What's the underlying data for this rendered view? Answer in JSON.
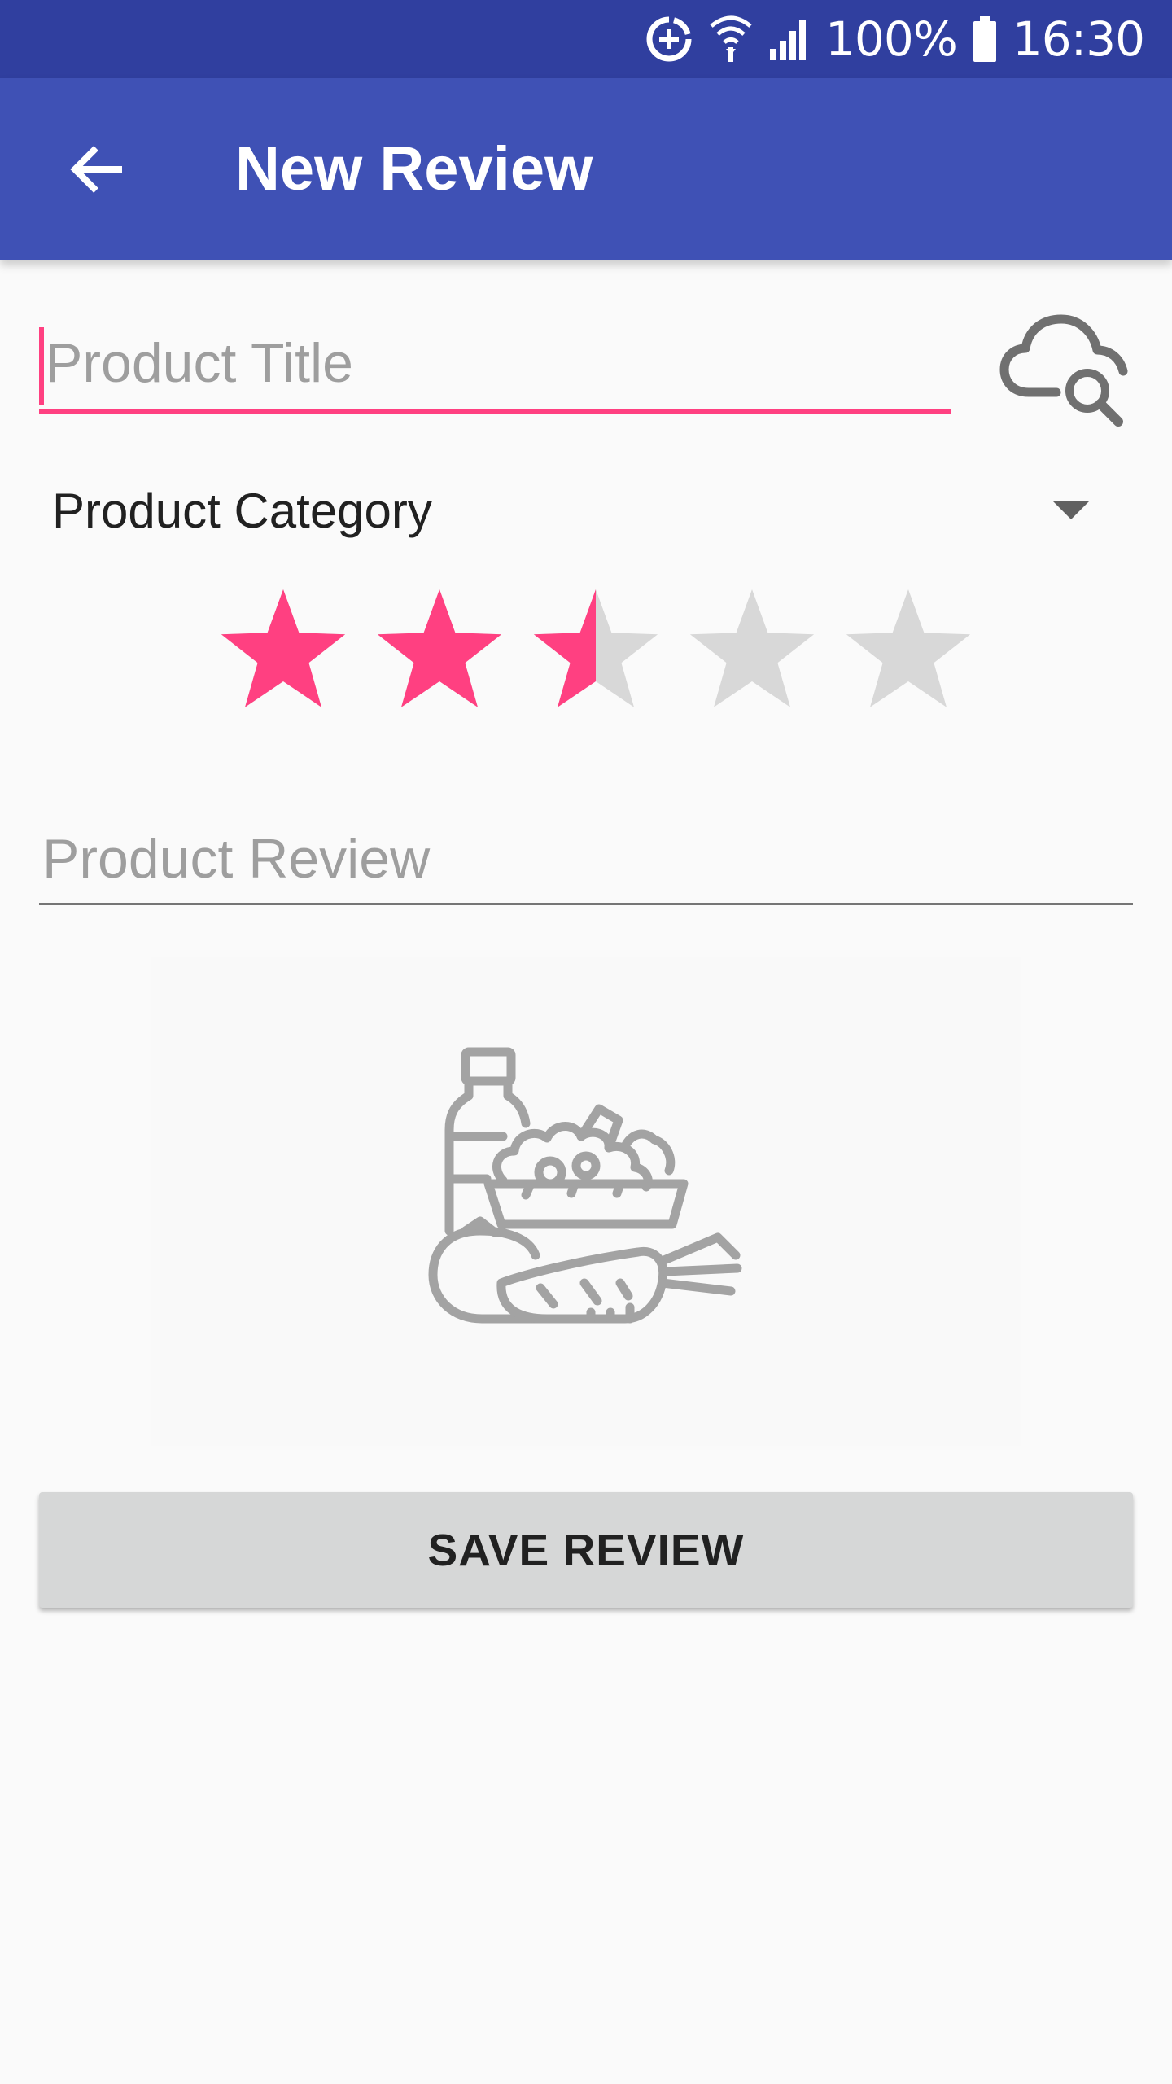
{
  "status_bar": {
    "battery": "100%",
    "time": "16:30"
  },
  "app_bar": {
    "title": "New Review",
    "back_icon": "arrow-back-icon"
  },
  "form": {
    "title_placeholder": "Product Title",
    "title_value": "",
    "search_icon": "cloud-search-icon",
    "category_selected": "Product Category",
    "rating": 2.5,
    "rating_max": 5,
    "review_placeholder": "Product Review",
    "review_value": "",
    "image_icon": "grocery-basket-icon",
    "save_label": "SAVE REVIEW"
  },
  "colors": {
    "status_bar": "#303f9f",
    "app_bar": "#3f51b5",
    "accent": "#ff4081",
    "star_empty": "#d8d8d8",
    "button": "#d6d7d7"
  }
}
